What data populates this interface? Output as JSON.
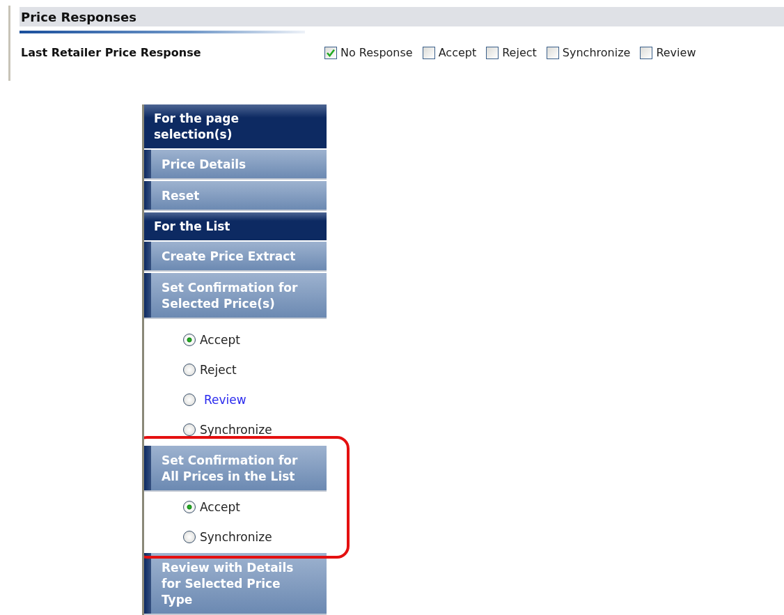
{
  "header": {
    "title": "Price Responses"
  },
  "filter": {
    "label": "Last Retailer Price Response",
    "options": [
      {
        "label": "No Response",
        "checked": true
      },
      {
        "label": "Accept",
        "checked": false
      },
      {
        "label": "Reject",
        "checked": false
      },
      {
        "label": "Synchronize",
        "checked": false
      },
      {
        "label": "Review",
        "checked": false
      }
    ]
  },
  "menu": {
    "items": [
      {
        "kind": "section",
        "label": "For the page selection(s)"
      },
      {
        "kind": "action",
        "label": "Price Details"
      },
      {
        "kind": "action",
        "label": "Reset"
      },
      {
        "kind": "section",
        "label": "For the List"
      },
      {
        "kind": "action",
        "label": "Create Price Extract"
      },
      {
        "kind": "action",
        "label": "Set Confirmation for Selected Price(s)",
        "highlighted": false,
        "options": [
          {
            "label": "Accept",
            "selected": true,
            "kind": "text"
          },
          {
            "label": "Reject",
            "selected": false,
            "kind": "text"
          },
          {
            "label": "Review",
            "selected": false,
            "kind": "link"
          },
          {
            "label": "Synchronize",
            "selected": false,
            "kind": "text"
          }
        ]
      },
      {
        "kind": "action",
        "label": "Set Confirmation for All Prices in the List",
        "highlighted": true,
        "options": [
          {
            "label": "Accept",
            "selected": true,
            "kind": "text"
          },
          {
            "label": "Synchronize",
            "selected": false,
            "kind": "text"
          }
        ]
      },
      {
        "kind": "action",
        "label": "Review with Details for Selected Price Type"
      }
    ]
  }
}
